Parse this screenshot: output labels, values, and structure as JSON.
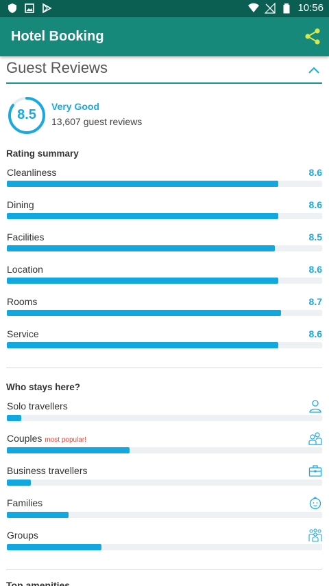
{
  "status_bar": {
    "time": "10:56"
  },
  "app_bar": {
    "title": "Hotel Booking"
  },
  "reviews": {
    "section_title": "Guest Reviews",
    "score": "8.5",
    "score_fraction": 0.85,
    "score_word": "Very Good",
    "review_count": "13,607 guest reviews"
  },
  "rating_summary": {
    "title": "Rating summary",
    "items": [
      {
        "label": "Cleanliness",
        "score": "8.6",
        "fraction": 0.86
      },
      {
        "label": "Dining",
        "score": "8.6",
        "fraction": 0.86
      },
      {
        "label": "Facilities",
        "score": "8.5",
        "fraction": 0.85
      },
      {
        "label": "Location",
        "score": "8.6",
        "fraction": 0.86
      },
      {
        "label": "Rooms",
        "score": "8.7",
        "fraction": 0.87
      },
      {
        "label": "Service",
        "score": "8.6",
        "fraction": 0.86
      }
    ]
  },
  "who_stays": {
    "title": "Who stays here?",
    "items": [
      {
        "label": "Solo travellers",
        "tag": "",
        "fraction": 0.045,
        "icon": "person-icon"
      },
      {
        "label": "Couples",
        "tag": "most popular!",
        "fraction": 0.39,
        "icon": "couple-icon"
      },
      {
        "label": "Business travellers",
        "tag": "",
        "fraction": 0.075,
        "icon": "briefcase-icon"
      },
      {
        "label": "Families",
        "tag": "",
        "fraction": 0.195,
        "icon": "baby-icon"
      },
      {
        "label": "Groups",
        "tag": "",
        "fraction": 0.3,
        "icon": "group-icon"
      }
    ]
  },
  "next_section": {
    "title": "Top amenities"
  },
  "colors": {
    "accent": "#12a8df",
    "app_bar": "#16897a",
    "status_bar": "#0b5f52",
    "share": "#d4e94a",
    "popular": "#e64a3b"
  }
}
